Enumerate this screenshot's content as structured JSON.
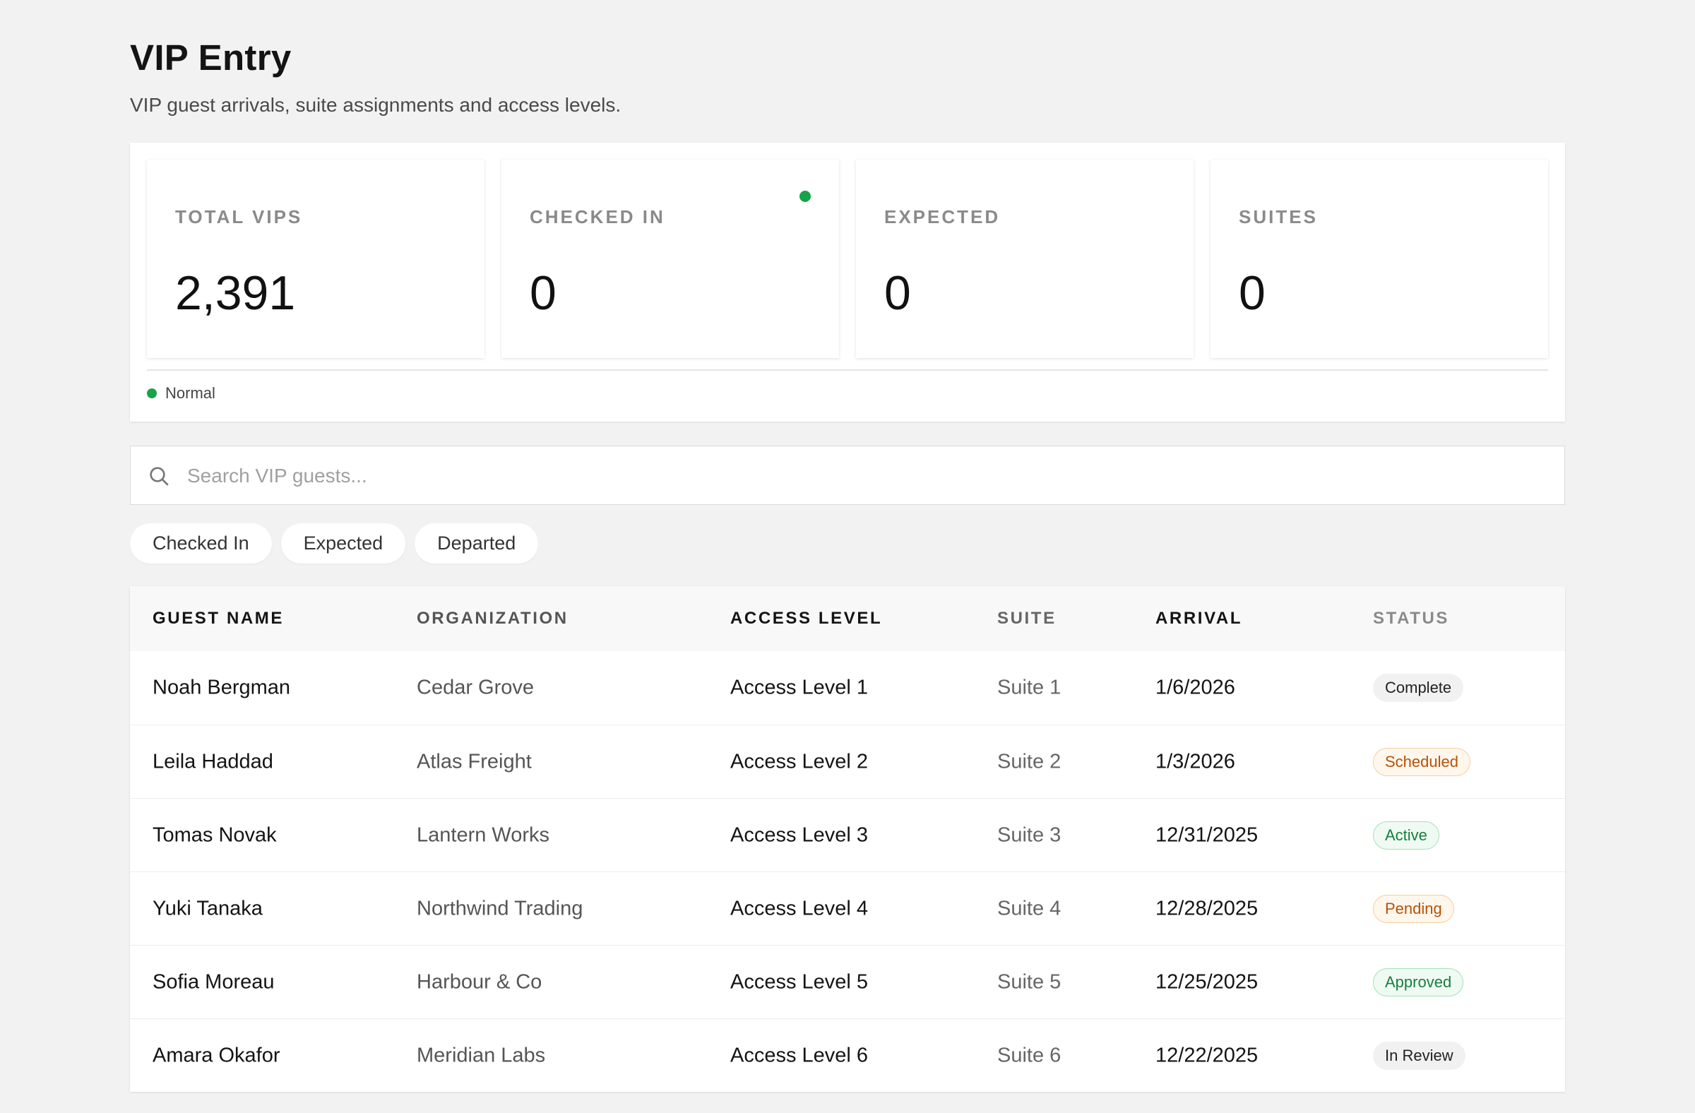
{
  "header": {
    "title": "VIP Entry",
    "subtitle": "VIP guest arrivals, suite assignments and access levels."
  },
  "stats": [
    {
      "label": "TOTAL VIPS",
      "value": "2,391",
      "live": false
    },
    {
      "label": "CHECKED IN",
      "value": "0",
      "live": true
    },
    {
      "label": "EXPECTED",
      "value": "0",
      "live": false
    },
    {
      "label": "SUITES",
      "value": "0",
      "live": false
    }
  ],
  "system_status": {
    "label": "Normal",
    "color": "#17a34a"
  },
  "search": {
    "placeholder": "Search VIP guests...",
    "value": "",
    "icon": "search-icon"
  },
  "filters": [
    "Checked In",
    "Expected",
    "Departed"
  ],
  "table": {
    "columns": [
      "GUEST NAME",
      "ORGANIZATION",
      "ACCESS LEVEL",
      "SUITE",
      "ARRIVAL",
      "STATUS"
    ],
    "rows": [
      {
        "name": "Noah Bergman",
        "organization": "Cedar Grove",
        "access": "Access Level 1",
        "suite": "Suite 1",
        "arrival": "1/6/2026",
        "status": "Complete",
        "tone": "neutral"
      },
      {
        "name": "Leila Haddad",
        "organization": "Atlas Freight",
        "access": "Access Level 2",
        "suite": "Suite 2",
        "arrival": "1/3/2026",
        "status": "Scheduled",
        "tone": "amber"
      },
      {
        "name": "Tomas Novak",
        "organization": "Lantern Works",
        "access": "Access Level 3",
        "suite": "Suite 3",
        "arrival": "12/31/2025",
        "status": "Active",
        "tone": "green"
      },
      {
        "name": "Yuki Tanaka",
        "organization": "Northwind Trading",
        "access": "Access Level 4",
        "suite": "Suite 4",
        "arrival": "12/28/2025",
        "status": "Pending",
        "tone": "amber"
      },
      {
        "name": "Sofia Moreau",
        "organization": "Harbour & Co",
        "access": "Access Level 5",
        "suite": "Suite 5",
        "arrival": "12/25/2025",
        "status": "Approved",
        "tone": "green"
      },
      {
        "name": "Amara Okafor",
        "organization": "Meridian Labs",
        "access": "Access Level 6",
        "suite": "Suite 6",
        "arrival": "12/22/2025",
        "status": "In Review",
        "tone": "neutral"
      }
    ]
  }
}
